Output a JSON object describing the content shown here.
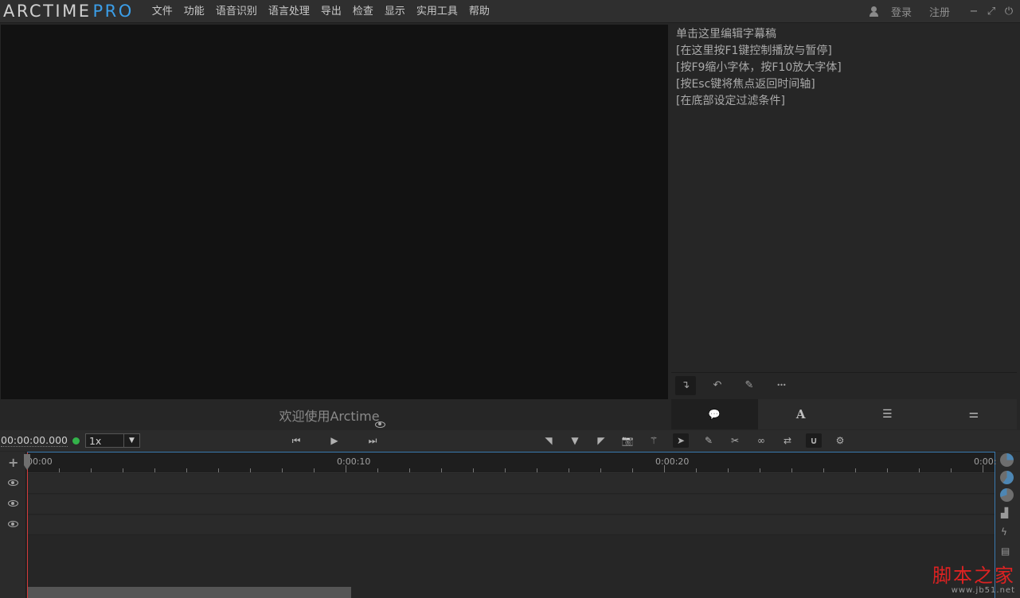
{
  "app": {
    "logo_main": "ARCTIME",
    "logo_pro": "PRO",
    "accent_color": "#3b9ee8"
  },
  "menu": [
    "文件",
    "功能",
    "语音识别",
    "语言处理",
    "导出",
    "检查",
    "显示",
    "实用工具",
    "帮助"
  ],
  "account": {
    "login": "登录",
    "register": "注册",
    "user_icon": "user-icon"
  },
  "window_controls": {
    "minimize": "−",
    "maximize": "⤢",
    "power": "⏻"
  },
  "video": {
    "welcome": "欢迎使用Arctime",
    "visibility_icon": "eye-icon"
  },
  "editor": {
    "lines": [
      "单击这里编辑字幕稿",
      "[在这里按F1键控制播放与暂停]",
      "[按F9缩小字体，按F10放大字体]",
      "[按Esc键将焦点返回时间轴]",
      "[在底部设定过滤条件]"
    ],
    "tools": [
      {
        "name": "insert-icon",
        "glyph": "↴"
      },
      {
        "name": "undo-icon",
        "glyph": "↶"
      },
      {
        "name": "pencil-icon",
        "glyph": "✎"
      },
      {
        "name": "more-icon",
        "glyph": "•••"
      }
    ],
    "tabs": [
      {
        "name": "comment-icon",
        "glyph": "💬"
      },
      {
        "name": "font-icon",
        "glyph": "A"
      },
      {
        "name": "list-icon",
        "glyph": "☰"
      },
      {
        "name": "settings-sliders-icon",
        "glyph": "⚌"
      }
    ]
  },
  "controls": {
    "timecode": "00:00:00.000",
    "speed": "1x",
    "speed_arrow": "▼",
    "status_color": "#33b24a",
    "transport": [
      {
        "name": "prev-icon",
        "glyph": "⏮"
      },
      {
        "name": "play-icon",
        "glyph": "▶"
      },
      {
        "name": "next-icon",
        "glyph": "⏭"
      }
    ],
    "tools": [
      {
        "name": "mark-in-icon",
        "glyph": "◥"
      },
      {
        "name": "mark-down-icon",
        "glyph": "▼"
      },
      {
        "name": "mark-out-icon",
        "glyph": "◤"
      },
      {
        "name": "camera-icon",
        "glyph": "📷"
      },
      {
        "name": "magic-wand-icon",
        "glyph": "⚚"
      },
      {
        "name": "pointer-icon",
        "glyph": "➤"
      },
      {
        "name": "edit-icon",
        "glyph": "✎"
      },
      {
        "name": "scissors-icon",
        "glyph": "✂"
      },
      {
        "name": "link-icon",
        "glyph": "∞"
      },
      {
        "name": "swap-icon",
        "glyph": "⇄"
      },
      {
        "name": "magnet-icon",
        "glyph": "∪"
      },
      {
        "name": "gear-icon",
        "glyph": "⚙"
      }
    ]
  },
  "timeline": {
    "ruler_labels": [
      "00:00",
      "0:00:10",
      "0:00:20",
      "0:00:"
    ],
    "track_count": 3,
    "add_glyph": "+",
    "selection_color": "#3c7db3",
    "playhead_color": "#d23a3a"
  },
  "right_strip": {
    "icons": [
      {
        "name": "pie-icon-1"
      },
      {
        "name": "pie-icon-2"
      },
      {
        "name": "pie-icon-3"
      },
      {
        "name": "waveform-icon",
        "glyph": "▟"
      },
      {
        "name": "lightning-icon",
        "glyph": "ϟ"
      },
      {
        "name": "list-panel-icon",
        "glyph": "▤"
      }
    ]
  },
  "watermark": {
    "main": "脚本之家",
    "sub": "www.jb51.net"
  }
}
